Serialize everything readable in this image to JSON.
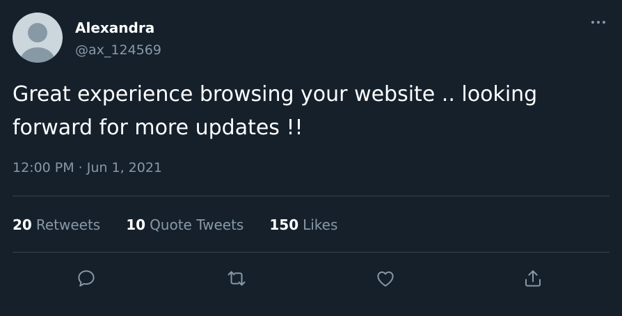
{
  "author": {
    "name": "Alexandra",
    "handle": "@ax_124569",
    "avatar_icon": "default-avatar-icon"
  },
  "tweet": {
    "text_line1": "Great experience browsing your website .. looking",
    "text_line2": "forward for more updates !!",
    "timestamp": "12:00 PM · Jun 1, 2021"
  },
  "stats": {
    "retweets": {
      "count": "20",
      "label": "Retweets"
    },
    "quote_tweets": {
      "count": "10",
      "label": "Quote Tweets"
    },
    "likes": {
      "count": "150",
      "label": "Likes"
    }
  },
  "actions": [
    {
      "name": "reply",
      "icon": "reply-icon"
    },
    {
      "name": "retweet",
      "icon": "retweet-icon"
    },
    {
      "name": "like",
      "icon": "heart-icon"
    },
    {
      "name": "share",
      "icon": "share-icon"
    }
  ],
  "menu_icon": "more-options-icon",
  "colors": {
    "background": "#15202b",
    "primary_text": "#ffffff",
    "secondary_text": "#8899a6",
    "divider": "#38444d",
    "avatar_bg": "#ccd6dd",
    "avatar_fg": "#657786"
  }
}
